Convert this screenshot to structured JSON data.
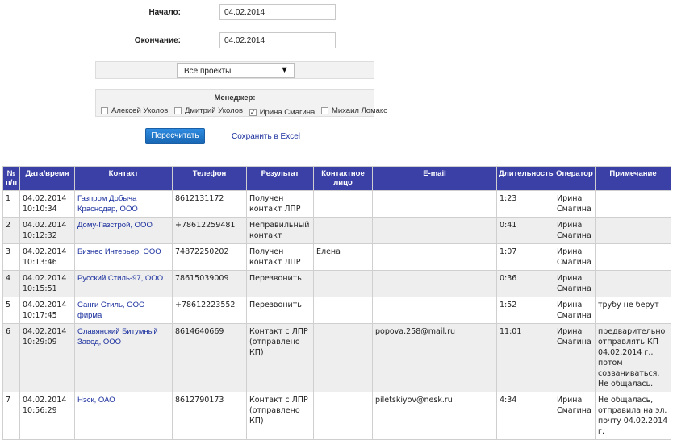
{
  "filters": {
    "start_label": "Начало:",
    "start_value": "04.02.2014",
    "end_label": "Окончание:",
    "end_value": "04.02.2014",
    "project_selected": "Все проекты",
    "manager_title": "Менеджер:",
    "managers": [
      {
        "name": "Алексей Уколов",
        "checked": false
      },
      {
        "name": "Дмитрий Уколов",
        "checked": false
      },
      {
        "name": "Ирина Смагина",
        "checked": true
      },
      {
        "name": "Михаил Ломако",
        "checked": false
      }
    ],
    "recalc_label": "Пересчитать",
    "excel_label": "Сохранить в Excel"
  },
  "table": {
    "headers": [
      "№ п/п",
      "Дата/время",
      "Контакт",
      "Телефон",
      "Результат",
      "Контактное лицо",
      "E-mail",
      "Длительность",
      "Оператор",
      "Примечание"
    ],
    "rows": [
      [
        "1",
        "04.02.2014 10:10:34",
        "Газпром Добыча Краснодар, ООО",
        "8612131172",
        "Получен контакт ЛПР",
        "",
        "",
        "1:23",
        "Ирина Смагина",
        ""
      ],
      [
        "2",
        "04.02.2014 10:12:32",
        "Дому-Газстрой, ООО",
        "+78612259481",
        "Неправильный контакт",
        "",
        "",
        "0:41",
        "Ирина Смагина",
        ""
      ],
      [
        "3",
        "04.02.2014 10:13:46",
        "Бизнес Интерьер, ООО",
        "74872250202",
        "Получен контакт ЛПР",
        "Елена",
        "",
        "1:07",
        "Ирина Смагина",
        ""
      ],
      [
        "4",
        "04.02.2014 10:15:51",
        "Русский Стиль-97, ООО",
        "78615039009",
        "Перезвонить",
        "",
        "",
        "0:36",
        "Ирина Смагина",
        ""
      ],
      [
        "5",
        "04.02.2014 10:17:45",
        "Санги Стиль, ООО фирма",
        "+78612223552",
        "Перезвонить",
        "",
        "",
        "1:52",
        "Ирина Смагина",
        "трубу не берут"
      ],
      [
        "6",
        "04.02.2014 10:29:09",
        "Славянский Битумный Завод, ООО",
        "8614640669",
        "Контакт с ЛПР (отправлено КП)",
        "",
        "popova.258@mail.ru",
        "11:01",
        "Ирина Смагина",
        "предварительно отправлять КП 04.02.2014 г., потом созваниваться. Не общалась."
      ],
      [
        "7",
        "04.02.2014 10:56:29",
        "Нэск, ОАО",
        "8612790173",
        "Контакт с ЛПР (отправлено КП)",
        "",
        "piletskiyov@nesk.ru",
        "4:34",
        "Ирина Смагина",
        "Не общалась, отправила на эл. почту 04.02.2014 г."
      ]
    ]
  }
}
